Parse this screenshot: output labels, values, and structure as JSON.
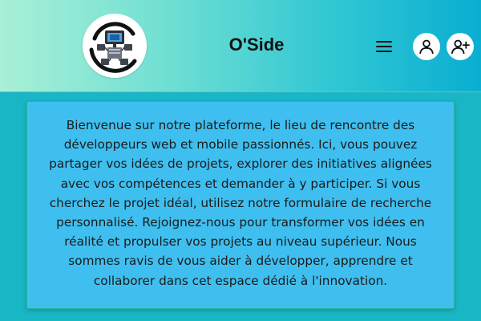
{
  "header": {
    "brand_name": "O'Side",
    "logo_icon": "computer-network-logo-icon",
    "menu_icon": "hamburger-menu-icon",
    "user_icon": "user-icon",
    "add_user_icon": "user-plus-icon",
    "colors": {
      "gradient_start": "#a9f0d6",
      "gradient_end": "#0aaed2"
    }
  },
  "main": {
    "intro_text": "Bienvenue sur notre plateforme, le lieu de rencontre des développeurs web et mobile passionnés. Ici, vous pouvez partager vos idées de projets, explorer des initiatives alignées avec vos compétences et demander à y participer. Si vous cherchez le projet idéal, utilisez notre formulaire de recherche personnalisé. Rejoignez-nous pour transformer vos idées en réalité et propulser vos projets au niveau supérieur. Nous sommes ravis de vous aider à développer, apprendre et collaborer dans cet espace dédié à l'innovation.",
    "colors": {
      "background": "#19b6c6",
      "card": "#3fbff0"
    }
  }
}
